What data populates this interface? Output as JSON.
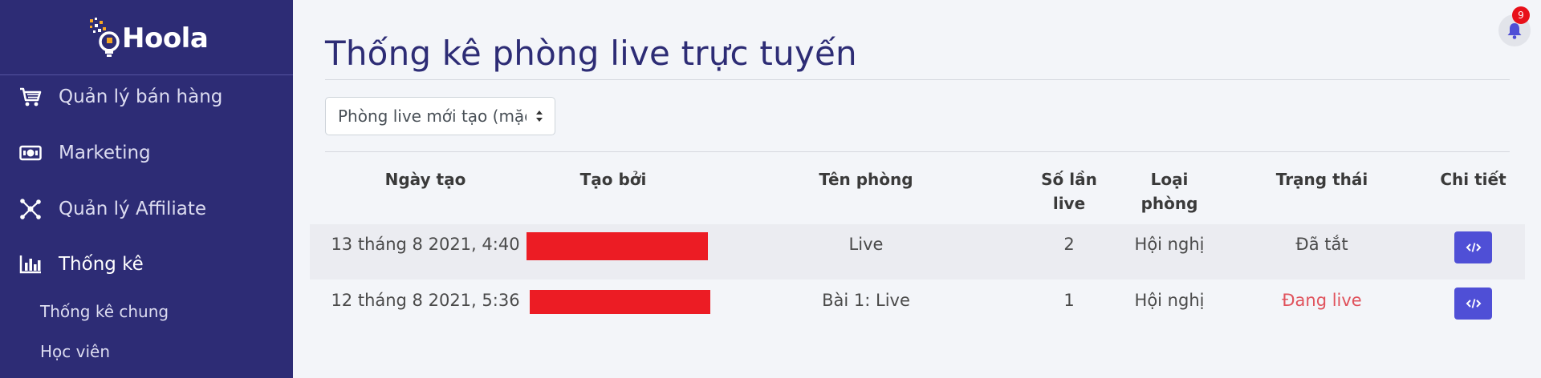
{
  "brand": {
    "name": "Hoola"
  },
  "sidebar": {
    "items": [
      {
        "label": "Quản lý bán hàng",
        "icon": "cart-icon"
      },
      {
        "label": "Marketing",
        "icon": "money-icon"
      },
      {
        "label": "Quản lý Affiliate",
        "icon": "network-icon"
      },
      {
        "label": "Thống kê",
        "icon": "bar-chart-icon"
      }
    ],
    "sub_items": [
      {
        "label": "Thống kê chung"
      },
      {
        "label": "Học viên"
      }
    ]
  },
  "page": {
    "title": "Thống kê phòng live trực tuyến"
  },
  "filter": {
    "selected": "Phòng live mới tạo (mặc định)"
  },
  "notifications": {
    "count": "9"
  },
  "table": {
    "headers": {
      "created_at": "Ngày tạo",
      "created_by": "Tạo bởi",
      "room_name": "Tên phòng",
      "live_count_1": "Số lần",
      "live_count_2": "live",
      "room_type_1": "Loại",
      "room_type_2": "phòng",
      "status": "Trạng thái",
      "detail": "Chi tiết"
    },
    "rows": [
      {
        "created_at": "13 tháng 8 2021, 4:40",
        "room_name": "Live",
        "live_count": "2",
        "room_type": "Hội nghị",
        "status": "Đã tắt"
      },
      {
        "created_at": "12 tháng 8 2021, 5:36",
        "room_name": "Bài 1: Live",
        "live_count": "1",
        "room_type": "Hội nghị",
        "status": "Đang live"
      }
    ]
  },
  "colors": {
    "sidebar": "#2d2c75",
    "accent": "#4f4fd6",
    "live_status": "#e0525c",
    "redaction": "#ec1c24"
  }
}
